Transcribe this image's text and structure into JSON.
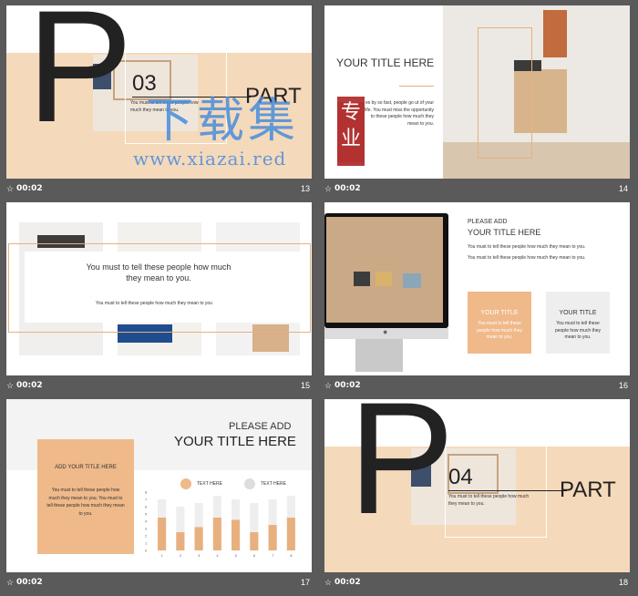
{
  "colors": {
    "peach": "#f5d9bb",
    "accent": "#e8b07f",
    "dark": "#222222"
  },
  "slides": [
    {
      "num": "13",
      "time": "00:02",
      "letter": "P",
      "index": "03",
      "part": "PART",
      "body": "You must to tell these people how much they mean to you."
    },
    {
      "num": "14",
      "time": "00:02",
      "title": "YOUR TITLE HERE",
      "body": "es by so fast, people go ut of your life. You must miss the opportunity to these people how much they mean to you."
    },
    {
      "num": "15",
      "time": "00:02",
      "headline": "You must to tell these people how much they mean to you.",
      "body": "You must to tell these people how much they mean to you"
    },
    {
      "num": "16",
      "time": "00:02",
      "kicker": "PLEASE ADD",
      "title": "YOUR TITLE HERE",
      "line1": "You must to tell these people how much they mean to you.",
      "line2": "You must to tell these people how much they mean to you.",
      "box1_title": "YOUR TITLE",
      "box1_body": "You must to tell these people how much they mean to you.",
      "box2_title": "YOUR TITLE",
      "box2_body": "You must to tell these people how much they mean to you."
    },
    {
      "num": "17",
      "time": "00:02",
      "kicker": "PLEASE ADD",
      "title": "YOUR TITLE HERE",
      "card_title": "ADD YOUR TITLE HERE",
      "card_body": "You must to tell these people how much they mean to you. You must to tell these people how much they mean to you.",
      "legend1": "TEXT HERE",
      "legend2": "TEXT HERE"
    },
    {
      "num": "18",
      "time": "00:02",
      "letter": "P",
      "index": "04",
      "part": "PART",
      "body": "You must to tell these people how much they mean to you."
    }
  ],
  "chart_data": {
    "type": "bar",
    "categories": [
      "1",
      "2",
      "3",
      "4",
      "5",
      "6",
      "7",
      "8"
    ],
    "ylim": [
      0,
      8
    ],
    "yticks": [
      "0",
      "1",
      "2",
      "3",
      "4",
      "5",
      "6",
      "7",
      "8"
    ],
    "series": [
      {
        "name": "",
        "values": [
          4.5,
          2.5,
          3.2,
          4.5,
          4.2,
          2.5,
          3.5,
          4.5
        ]
      },
      {
        "name": "",
        "values": [
          7,
          6,
          6.5,
          7.5,
          7,
          6.5,
          7,
          7.5
        ]
      }
    ]
  },
  "watermark": {
    "cn_top": "下载集",
    "cn_seal": "专业",
    "url": "www.xiazai.red"
  }
}
